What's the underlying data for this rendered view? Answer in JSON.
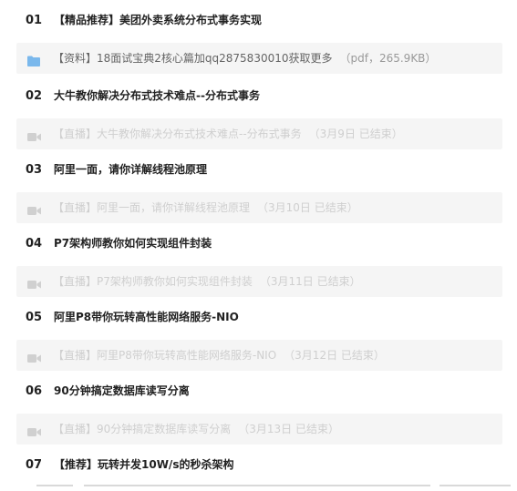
{
  "courses": [
    {
      "num": "01",
      "title": "【精品推荐】美团外卖系统分布式事务实现",
      "item": {
        "icon": "folder-icon",
        "kind": "doc",
        "text": "【资料】18面试宝典2核心篇加qq2875830010获取更多",
        "meta": "（pdf，265.9KB）"
      }
    },
    {
      "num": "02",
      "title": "大牛教你解决分布式技术难点--分布式事务",
      "item": {
        "icon": "video-camera-icon",
        "kind": "live",
        "text": "【直播】大牛教你解决分布式技术难点--分布式事务",
        "meta": "（3月9日 已结束）"
      }
    },
    {
      "num": "03",
      "title": "阿里一面，请你详解线程池原理",
      "item": {
        "icon": "video-camera-icon",
        "kind": "live",
        "text": "【直播】阿里一面，请你详解线程池原理",
        "meta": "（3月10日 已结束）"
      }
    },
    {
      "num": "04",
      "title": "P7架构师教你如何实现组件封装",
      "item": {
        "icon": "video-camera-icon",
        "kind": "live",
        "text": "【直播】P7架构师教你如何实现组件封装",
        "meta": "（3月11日 已结束）"
      }
    },
    {
      "num": "05",
      "title": "阿里P8带你玩转高性能网络服务-NIO",
      "item": {
        "icon": "video-camera-icon",
        "kind": "live",
        "text": "【直播】阿里P8带你玩转高性能网络服务-NIO",
        "meta": "（3月12日 已结束）"
      }
    },
    {
      "num": "06",
      "title": "90分钟搞定数据库读写分离",
      "item": {
        "icon": "video-camera-icon",
        "kind": "live",
        "text": "【直播】90分钟搞定数据库读写分离",
        "meta": "（3月13日 已结束）"
      }
    },
    {
      "num": "07",
      "title": "【推荐】玩转并发10W/s的秒杀架构",
      "item": null
    }
  ],
  "colors": {
    "folder_icon": "#7ab8ec",
    "camera_icon": "#d0d0d0",
    "row_bg": "#f5f5f5",
    "disabled_text": "#cfcfcf"
  }
}
